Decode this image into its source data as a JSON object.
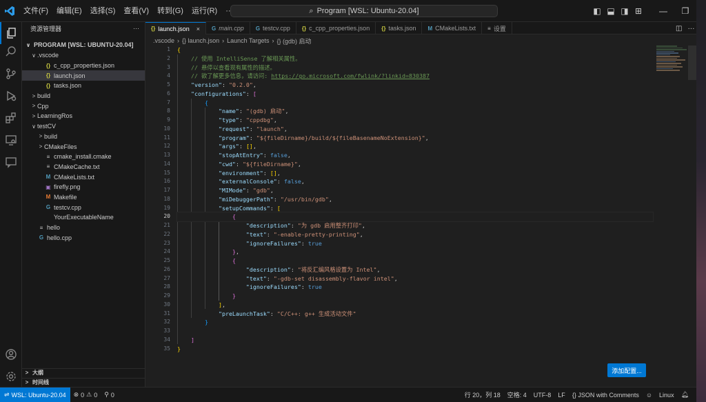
{
  "window": {
    "title": "Program [WSL: Ubuntu-20.04]",
    "menu": [
      "文件(F)",
      "编辑(E)",
      "选择(S)",
      "查看(V)",
      "转到(G)",
      "运行(R)",
      "···"
    ]
  },
  "sidebar": {
    "header": "资源管理器",
    "header_more": "···",
    "root": "PROGRAM [WSL: UBUNTU-20.04]",
    "tree": [
      {
        "label": ".vscode",
        "depth": 1,
        "chev": "∨",
        "icon": "",
        "cls": ""
      },
      {
        "label": "c_cpp_properties.json",
        "depth": 2,
        "chev": "",
        "icon": "{}",
        "cls": "json"
      },
      {
        "label": "launch.json",
        "depth": 2,
        "chev": "",
        "icon": "{}",
        "cls": "json",
        "selected": true
      },
      {
        "label": "tasks.json",
        "depth": 2,
        "chev": "",
        "icon": "{}",
        "cls": "json"
      },
      {
        "label": "build",
        "depth": 1,
        "chev": ">",
        "icon": "",
        "cls": ""
      },
      {
        "label": "Cpp",
        "depth": 1,
        "chev": ">",
        "icon": "",
        "cls": ""
      },
      {
        "label": "LearningRos",
        "depth": 1,
        "chev": ">",
        "icon": "",
        "cls": ""
      },
      {
        "label": "testCV",
        "depth": 1,
        "chev": "∨",
        "icon": "",
        "cls": ""
      },
      {
        "label": "build",
        "depth": 2,
        "chev": ">",
        "icon": "",
        "cls": ""
      },
      {
        "label": "CMakeFiles",
        "depth": 2,
        "chev": ">",
        "icon": "",
        "cls": ""
      },
      {
        "label": "cmake_install.cmake",
        "depth": 2,
        "chev": "",
        "icon": "≡",
        "cls": "txt"
      },
      {
        "label": "CMakeCache.txt",
        "depth": 2,
        "chev": "",
        "icon": "≡",
        "cls": "txt"
      },
      {
        "label": "CMakeLists.txt",
        "depth": 2,
        "chev": "",
        "icon": "M",
        "cls": "cmake"
      },
      {
        "label": "firefly.png",
        "depth": 2,
        "chev": "",
        "icon": "▣",
        "cls": "png"
      },
      {
        "label": "Makefile",
        "depth": 2,
        "chev": "",
        "icon": "M",
        "cls": "make"
      },
      {
        "label": "testcv.cpp",
        "depth": 2,
        "chev": "",
        "icon": "G",
        "cls": "cpp"
      },
      {
        "label": "YourExecutableName",
        "depth": 2,
        "chev": "",
        "icon": "",
        "cls": ""
      },
      {
        "label": "hello",
        "depth": 1,
        "chev": "",
        "icon": "≡",
        "cls": "txt"
      },
      {
        "label": "hello.cpp",
        "depth": 1,
        "chev": "",
        "icon": "G",
        "cls": "cpp"
      }
    ],
    "outline": "大纲",
    "timeline": "时间线"
  },
  "tabs": [
    {
      "label": "launch.json",
      "icon": "{}",
      "cls": "json",
      "active": true,
      "close": "×"
    },
    {
      "label": "main.cpp",
      "icon": "G",
      "cls": "cpp",
      "italic": true
    },
    {
      "label": "testcv.cpp",
      "icon": "G",
      "cls": "cpp"
    },
    {
      "label": "c_cpp_properties.json",
      "icon": "{}",
      "cls": "json"
    },
    {
      "label": "tasks.json",
      "icon": "{}",
      "cls": "json"
    },
    {
      "label": "CMakeLists.txt",
      "icon": "M",
      "cls": "cmake"
    },
    {
      "label": "设置",
      "icon": "≡",
      "cls": "txt"
    }
  ],
  "breadcrumb": [
    ".vscode",
    "{} launch.json",
    "Launch Targets",
    "{} (gdb) 启动"
  ],
  "code": [
    [
      [
        "b1",
        "{"
      ]
    ],
    [
      [
        "",
        "    "
      ],
      [
        "cmt",
        "// 使用 IntelliSense 了解相关属性。"
      ]
    ],
    [
      [
        "",
        "    "
      ],
      [
        "cmt",
        "// 悬停以查看现有属性的描述。"
      ]
    ],
    [
      [
        "",
        "    "
      ],
      [
        "cmt",
        "// 欲了解更多信息，请访问: "
      ],
      [
        "link",
        "https://go.microsoft.com/fwlink/?linkid=830387"
      ]
    ],
    [
      [
        "",
        "    "
      ],
      [
        "key",
        "\"version\""
      ],
      [
        "",
        ": "
      ],
      [
        "str",
        "\"0.2.0\""
      ],
      [
        "",
        ","
      ]
    ],
    [
      [
        "",
        "    "
      ],
      [
        "key",
        "\"configurations\""
      ],
      [
        "",
        ": "
      ],
      [
        "b2",
        "["
      ]
    ],
    [
      [
        "",
        "        "
      ],
      [
        "b3",
        "{"
      ]
    ],
    [
      [
        "",
        "            "
      ],
      [
        "key",
        "\"name\""
      ],
      [
        "",
        ": "
      ],
      [
        "str",
        "\"(gdb) 启动\""
      ],
      [
        "",
        ","
      ]
    ],
    [
      [
        "",
        "            "
      ],
      [
        "key",
        "\"type\""
      ],
      [
        "",
        ": "
      ],
      [
        "str",
        "\"cppdbg\""
      ],
      [
        "",
        ","
      ]
    ],
    [
      [
        "",
        "            "
      ],
      [
        "key",
        "\"request\""
      ],
      [
        "",
        ": "
      ],
      [
        "str",
        "\"launch\""
      ],
      [
        "",
        ","
      ]
    ],
    [
      [
        "",
        "            "
      ],
      [
        "key",
        "\"program\""
      ],
      [
        "",
        ": "
      ],
      [
        "str",
        "\"${fileDirname}/build/${fileBasenameNoExtension}\""
      ],
      [
        "",
        ","
      ]
    ],
    [
      [
        "",
        "            "
      ],
      [
        "key",
        "\"args\""
      ],
      [
        "",
        ": "
      ],
      [
        "b1",
        "[]"
      ],
      [
        "",
        ","
      ]
    ],
    [
      [
        "",
        "            "
      ],
      [
        "key",
        "\"stopAtEntry\""
      ],
      [
        "",
        ": "
      ],
      [
        "bool",
        "false"
      ],
      [
        "",
        ","
      ]
    ],
    [
      [
        "",
        "            "
      ],
      [
        "key",
        "\"cwd\""
      ],
      [
        "",
        ": "
      ],
      [
        "str",
        "\"${fileDirname}\""
      ],
      [
        "",
        ","
      ]
    ],
    [
      [
        "",
        "            "
      ],
      [
        "key",
        "\"environment\""
      ],
      [
        "",
        ": "
      ],
      [
        "b1",
        "[]"
      ],
      [
        "",
        ","
      ]
    ],
    [
      [
        "",
        "            "
      ],
      [
        "key",
        "\"externalConsole\""
      ],
      [
        "",
        ": "
      ],
      [
        "bool",
        "false"
      ],
      [
        "",
        ","
      ]
    ],
    [
      [
        "",
        "            "
      ],
      [
        "key",
        "\"MIMode\""
      ],
      [
        "",
        ": "
      ],
      [
        "str",
        "\"gdb\""
      ],
      [
        "",
        ","
      ]
    ],
    [
      [
        "",
        "            "
      ],
      [
        "key",
        "\"miDebuggerPath\""
      ],
      [
        "",
        ": "
      ],
      [
        "str",
        "\"/usr/bin/gdb\""
      ],
      [
        "",
        ","
      ]
    ],
    [
      [
        "",
        "            "
      ],
      [
        "key",
        "\"setupCommands\""
      ],
      [
        "",
        ": "
      ],
      [
        "b1",
        "["
      ]
    ],
    [
      [
        "",
        "                "
      ],
      [
        "b2",
        "{"
      ]
    ],
    [
      [
        "",
        "                    "
      ],
      [
        "key",
        "\"description\""
      ],
      [
        "",
        ": "
      ],
      [
        "str",
        "\"为 gdb 启用整齐打印\""
      ],
      [
        "",
        ","
      ]
    ],
    [
      [
        "",
        "                    "
      ],
      [
        "key",
        "\"text\""
      ],
      [
        "",
        ": "
      ],
      [
        "str",
        "\"-enable-pretty-printing\""
      ],
      [
        "",
        ","
      ]
    ],
    [
      [
        "",
        "                    "
      ],
      [
        "key",
        "\"ignoreFailures\""
      ],
      [
        "",
        ": "
      ],
      [
        "bool",
        "true"
      ]
    ],
    [
      [
        "",
        "                "
      ],
      [
        "b2",
        "}"
      ],
      [
        "",
        ","
      ]
    ],
    [
      [
        "",
        "                "
      ],
      [
        "b2",
        "{"
      ]
    ],
    [
      [
        "",
        "                    "
      ],
      [
        "key",
        "\"description\""
      ],
      [
        "",
        ": "
      ],
      [
        "str",
        "\"将反汇编风格设置为 Intel\""
      ],
      [
        "",
        ","
      ]
    ],
    [
      [
        "",
        "                    "
      ],
      [
        "key",
        "\"text\""
      ],
      [
        "",
        ": "
      ],
      [
        "str",
        "\"-gdb-set disassembly-flavor intel\""
      ],
      [
        "",
        ","
      ]
    ],
    [
      [
        "",
        "                    "
      ],
      [
        "key",
        "\"ignoreFailures\""
      ],
      [
        "",
        ": "
      ],
      [
        "bool",
        "true"
      ]
    ],
    [
      [
        "",
        "                "
      ],
      [
        "b2",
        "}"
      ]
    ],
    [
      [
        "",
        "            "
      ],
      [
        "b1",
        "]"
      ],
      [
        "",
        ","
      ]
    ],
    [
      [
        "",
        "            "
      ],
      [
        "key",
        "\"preLaunchTask\""
      ],
      [
        "",
        ": "
      ],
      [
        "str",
        "\"C/C++: g++ 生成活动文件\""
      ]
    ],
    [
      [
        "",
        "        "
      ],
      [
        "b3",
        "}"
      ]
    ],
    [
      [
        "",
        ""
      ]
    ],
    [
      [
        "",
        "    "
      ],
      [
        "b2",
        "]"
      ]
    ],
    [
      [
        "b1",
        "}"
      ]
    ]
  ],
  "current_line": 20,
  "add_config_label": "添加配置...",
  "status": {
    "remote": "WSL: Ubuntu-20.04",
    "errors": "0",
    "warnings": "0",
    "ports": "0",
    "position": "行 20，列 18",
    "spaces": "空格: 4",
    "encoding": "UTF-8",
    "eol": "LF",
    "language": "{} JSON with Comments",
    "os": "Linux"
  },
  "colors": {
    "accent": "#0078d4",
    "background": "#1f1f1f",
    "chrome": "#181818"
  }
}
